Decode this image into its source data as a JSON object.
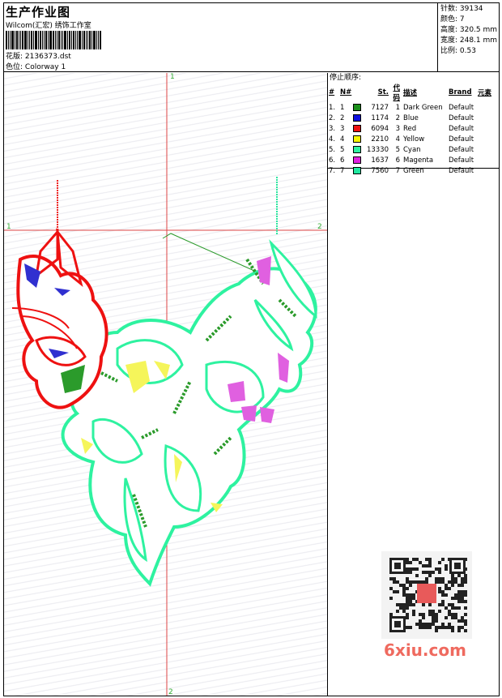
{
  "header": {
    "title": "生产作业图",
    "studio": "Wilcom(汇宏) 绣饰工作室",
    "file_label": "花版:",
    "file_value": "2136373.dst",
    "colorway_label": "色位:",
    "colorway_value": "Colorway 1"
  },
  "stats": {
    "stitches": "针数: 39134",
    "colors": "颜色: 7",
    "height": "高度: 320.5 mm",
    "width": "宽度: 248.1 mm",
    "scale": "比例: 0.53"
  },
  "axes": {
    "top": "1",
    "bottom": "2",
    "left": "1",
    "right": "2"
  },
  "stop_sequence": {
    "title": "停止顺序:",
    "headers": [
      "#",
      "N#",
      "St.",
      "代码",
      "描述",
      "Brand",
      "元素"
    ],
    "rows": [
      {
        "num": "1.",
        "n": "1",
        "color": "#1a8f1a",
        "st": "7127",
        "code": "1",
        "desc": "Dark Green",
        "brand": "Default"
      },
      {
        "num": "2.",
        "n": "2",
        "color": "#1010e0",
        "st": "1174",
        "code": "2",
        "desc": "Blue",
        "brand": "Default"
      },
      {
        "num": "3.",
        "n": "3",
        "color": "#ee1111",
        "st": "6094",
        "code": "3",
        "desc": "Red",
        "brand": "Default"
      },
      {
        "num": "4.",
        "n": "4",
        "color": "#f6f600",
        "st": "2210",
        "code": "4",
        "desc": "Yellow",
        "brand": "Default"
      },
      {
        "num": "5.",
        "n": "5",
        "color": "#2ef2a0",
        "st": "13330",
        "code": "5",
        "desc": "Cyan",
        "brand": "Default"
      },
      {
        "num": "6.",
        "n": "6",
        "color": "#e020e0",
        "st": "1637",
        "code": "6",
        "desc": "Magenta",
        "brand": "Default"
      },
      {
        "num": "7.",
        "n": "7",
        "color": "#20e8a0",
        "st": "7560",
        "code": "7",
        "desc": "Green",
        "brand": "Default"
      }
    ]
  },
  "watermark": "6xiu.com"
}
